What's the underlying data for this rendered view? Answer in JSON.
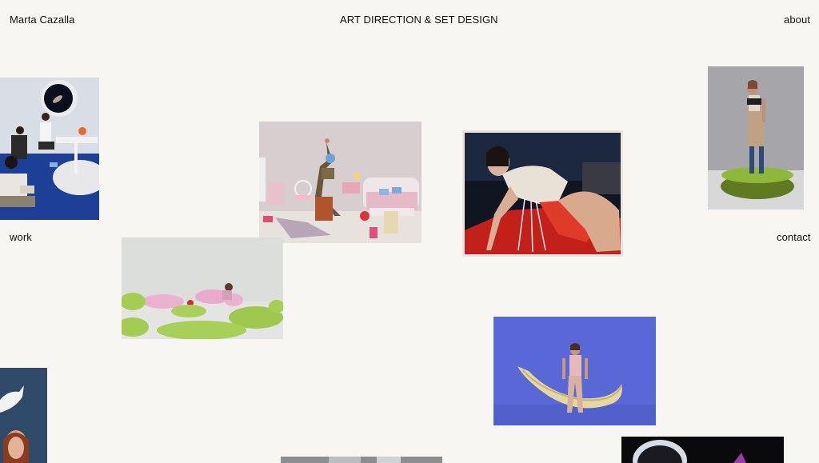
{
  "header": {
    "name": "Marta Cazalla",
    "title": "ART DIRECTION & SET DESIGN",
    "about": "about"
  },
  "nav": {
    "work": "work",
    "contact": "contact"
  },
  "colors": {
    "background": "#f7f6f3",
    "text": "#111111"
  }
}
